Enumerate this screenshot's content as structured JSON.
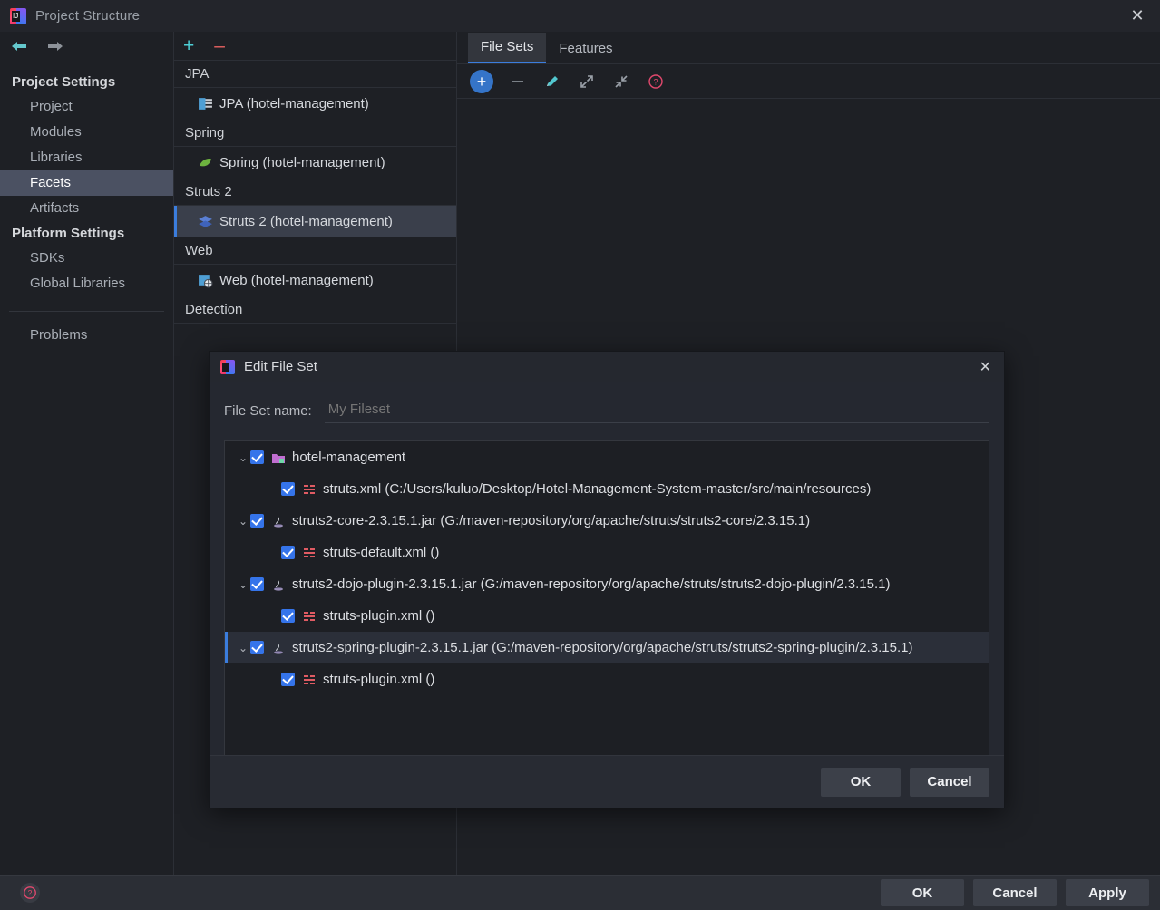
{
  "window": {
    "title": "Project Structure",
    "close_icon": "close-icon",
    "app_icon": "intellij-idea-icon"
  },
  "sidebar": {
    "nav": {
      "back_icon": "arrow-left-icon",
      "forward_icon": "arrow-right-icon"
    },
    "groups": [
      {
        "label": "Project Settings",
        "items": [
          {
            "label": "Project",
            "selected": false
          },
          {
            "label": "Modules",
            "selected": false
          },
          {
            "label": "Libraries",
            "selected": false
          },
          {
            "label": "Facets",
            "selected": true
          },
          {
            "label": "Artifacts",
            "selected": false
          }
        ]
      },
      {
        "label": "Platform Settings",
        "items": [
          {
            "label": "SDKs",
            "selected": false
          },
          {
            "label": "Global Libraries",
            "selected": false
          }
        ]
      }
    ],
    "problems": {
      "label": "Problems"
    }
  },
  "facets": {
    "toolbar": {
      "add_label": "+",
      "remove_label": "–"
    },
    "sections": [
      {
        "group": "JPA",
        "item": {
          "label": "JPA (hotel-management)",
          "icon": "jpa-icon",
          "selected": false
        }
      },
      {
        "group": "Spring",
        "item": {
          "label": "Spring (hotel-management)",
          "icon": "spring-leaf-icon",
          "selected": false
        }
      },
      {
        "group": "Struts 2",
        "item": {
          "label": "Struts 2 (hotel-management)",
          "icon": "struts2-icon",
          "selected": true
        }
      },
      {
        "group": "Web",
        "item": {
          "label": "Web (hotel-management)",
          "icon": "web-icon",
          "selected": false
        }
      }
    ],
    "detection_group": "Detection"
  },
  "details": {
    "tabs": [
      {
        "label": "File Sets",
        "active": true
      },
      {
        "label": "Features",
        "active": false
      }
    ],
    "toolbar": [
      {
        "name": "add-fileset-button",
        "icon": "plus-icon",
        "label": "+"
      },
      {
        "name": "remove-fileset-button",
        "icon": "minus-icon",
        "label": "–"
      },
      {
        "name": "edit-fileset-button",
        "icon": "pencil-icon",
        "label": ""
      },
      {
        "name": "expand-all-button",
        "icon": "expand-arrows-icon",
        "label": ""
      },
      {
        "name": "collapse-all-button",
        "icon": "collapse-arrows-icon",
        "label": ""
      },
      {
        "name": "help-button",
        "icon": "help-circle-icon",
        "label": "?"
      }
    ]
  },
  "edit_dialog": {
    "title": "Edit File Set",
    "close_icon": "close-icon",
    "name_label": "File Set name:",
    "name_value": "My Fileset",
    "name_placeholder": "My Fileset",
    "tree": [
      {
        "depth": 0,
        "chevron": "⌄",
        "checked": true,
        "icon": "module-folder-icon",
        "label": "hotel-management",
        "selected": false
      },
      {
        "depth": 1,
        "chevron": "",
        "checked": true,
        "icon": "xml-file-icon",
        "label": "struts.xml (C:/Users/kuluo/Desktop/Hotel-Management-System-master/src/main/resources)",
        "selected": false
      },
      {
        "depth": 0,
        "chevron": "⌄",
        "checked": true,
        "icon": "jar-file-icon",
        "label": "struts2-core-2.3.15.1.jar (G:/maven-repository/org/apache/struts/struts2-core/2.3.15.1)",
        "selected": false
      },
      {
        "depth": 1,
        "chevron": "",
        "checked": true,
        "icon": "xml-file-icon",
        "label": "struts-default.xml ()",
        "selected": false
      },
      {
        "depth": 0,
        "chevron": "⌄",
        "checked": true,
        "icon": "jar-file-icon",
        "label": "struts2-dojo-plugin-2.3.15.1.jar (G:/maven-repository/org/apache/struts/struts2-dojo-plugin/2.3.15.1)",
        "selected": false
      },
      {
        "depth": 1,
        "chevron": "",
        "checked": true,
        "icon": "xml-file-icon",
        "label": "struts-plugin.xml ()",
        "selected": false
      },
      {
        "depth": 0,
        "chevron": "⌄",
        "checked": true,
        "icon": "jar-file-icon",
        "label": "struts2-spring-plugin-2.3.15.1.jar (G:/maven-repository/org/apache/struts/struts2-spring-plugin/2.3.15.1)",
        "selected": true
      },
      {
        "depth": 1,
        "chevron": "",
        "checked": true,
        "icon": "xml-file-icon",
        "label": "struts-plugin.xml ()",
        "selected": false
      }
    ],
    "ok_label": "OK",
    "cancel_label": "Cancel"
  },
  "footer": {
    "help_icon": "help-circle-icon",
    "ok_label": "OK",
    "cancel_label": "Cancel",
    "apply_label": "Apply"
  },
  "colors": {
    "background": "#1e2025",
    "panel": "#252830",
    "accent_blue": "#3b7ddd",
    "checkbox_blue": "#3574ea",
    "selection_sidebar": "#4b5162",
    "help_pink": "#e2486d",
    "teal": "#4ecfd6",
    "red": "#e46060"
  }
}
